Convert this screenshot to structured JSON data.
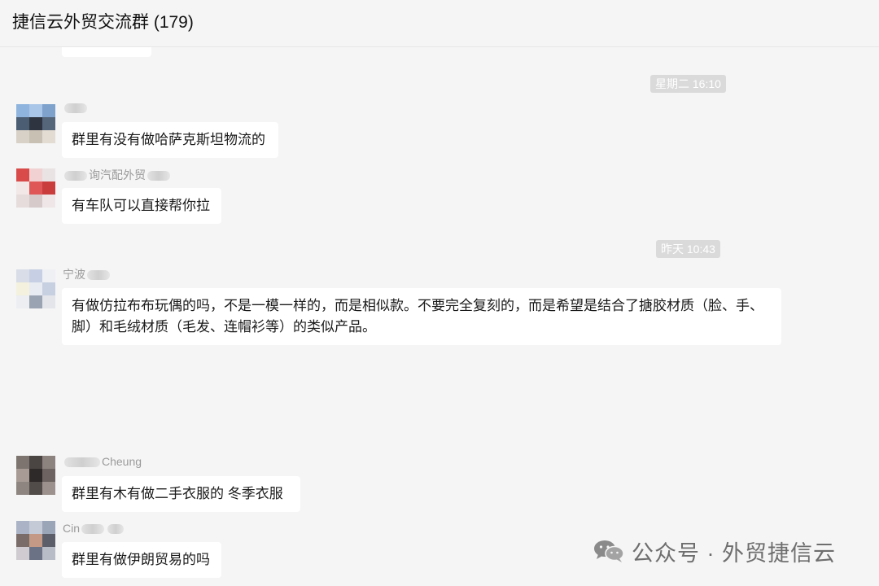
{
  "header": {
    "title": "捷信云外贸交流群 (179)"
  },
  "timestamps": [
    "星期二 16:10",
    "昨天 10:43"
  ],
  "messages": [
    {
      "name": "",
      "text": "群里有没有做哈萨克斯坦物流的"
    },
    {
      "name": "询汽配外贸",
      "text": "有车队可以直接帮你拉"
    },
    {
      "name": "宁波",
      "text": "有做仿拉布布玩偶的吗，不是一模一样的，而是相似款。不要完全复刻的，而是希望是结合了搪胶材质（脸、手、脚）和毛绒材质（毛发、连帽衫等）的类似产品。"
    },
    {
      "name": "Cheung",
      "text": "群里有木有做二手衣服的  冬季衣服"
    },
    {
      "name": "Cin",
      "text": "群里有做伊朗贸易的吗"
    }
  ],
  "watermark": {
    "text": "公众号 · 外贸捷信云",
    "icon": "wechat-icon"
  }
}
